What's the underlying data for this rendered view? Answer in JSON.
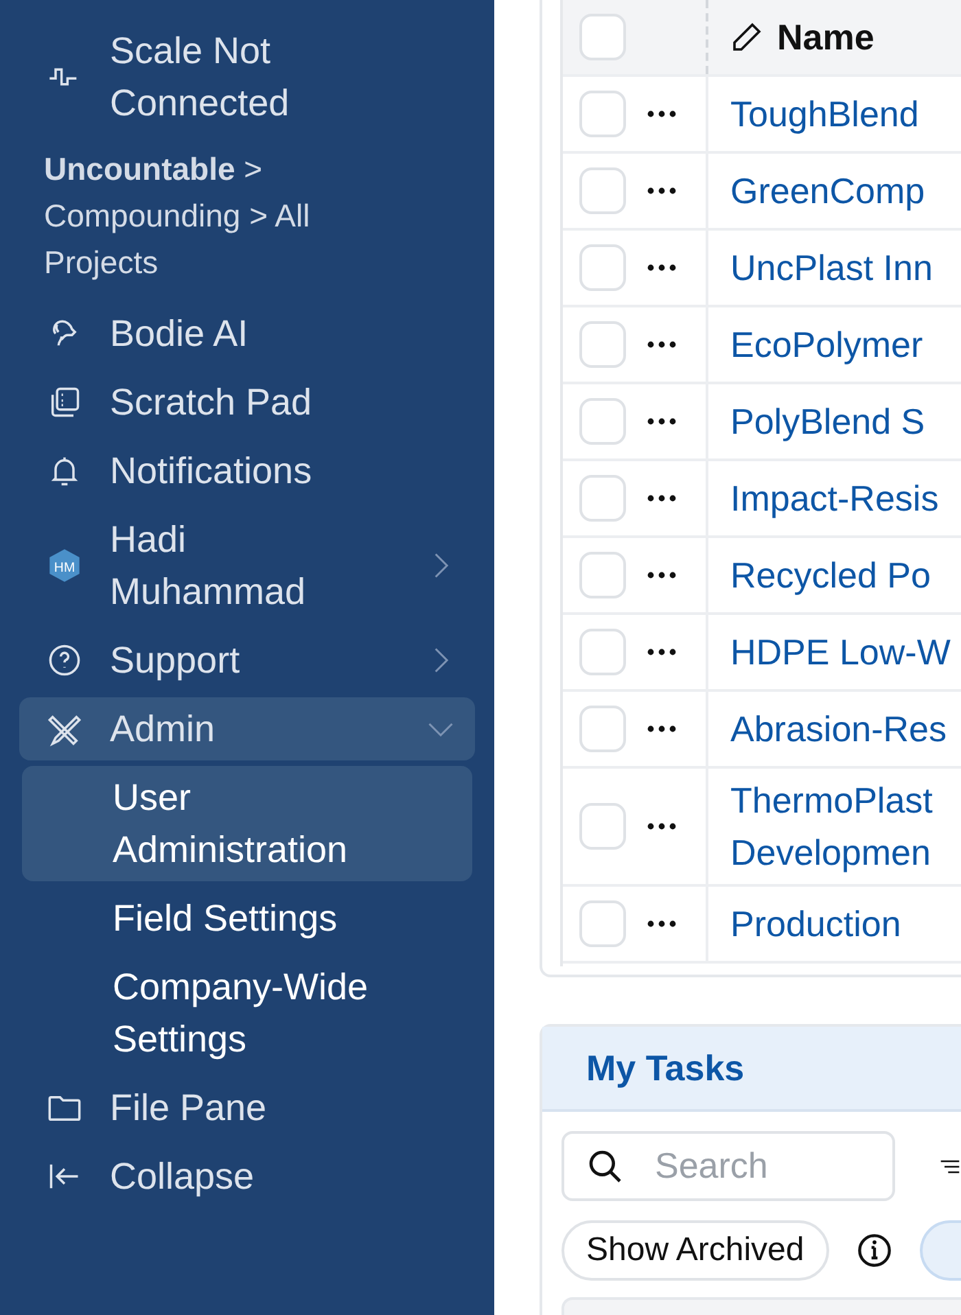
{
  "sidebar": {
    "scale_status": "Scale Not Connected",
    "breadcrumb": {
      "root": "Uncountable",
      "path": " > Compounding > All Projects"
    },
    "items": [
      {
        "kind": "nav",
        "label": "Bodie AI"
      },
      {
        "kind": "nav",
        "label": "Scratch Pad"
      },
      {
        "kind": "nav",
        "label": "Notifications"
      },
      {
        "kind": "user",
        "initials": "HM",
        "label": "Hadi Muhammad",
        "expanded": false
      },
      {
        "kind": "nav",
        "label": "Support",
        "expanded": false
      },
      {
        "kind": "nav",
        "label": "Admin",
        "expanded": true,
        "children": [
          {
            "label": "User Administration",
            "selected": true
          },
          {
            "label": "Field Settings",
            "selected": false
          },
          {
            "label": "Company-Wide Settings",
            "selected": false
          }
        ]
      },
      {
        "kind": "nav",
        "label": "File Pane"
      },
      {
        "kind": "nav",
        "label": "Collapse"
      }
    ]
  },
  "projects_table": {
    "all_selected": false,
    "columns": [
      {
        "label": "Name"
      }
    ],
    "rows": [
      {
        "checked": false,
        "name": "ToughBlend"
      },
      {
        "checked": false,
        "name": "GreenComp"
      },
      {
        "checked": false,
        "name": "UncPlast Inn"
      },
      {
        "checked": false,
        "name": "EcoPolymer"
      },
      {
        "checked": false,
        "name": "PolyBlend S"
      },
      {
        "checked": false,
        "name": "Impact-Resis"
      },
      {
        "checked": false,
        "name": "Recycled Po"
      },
      {
        "checked": false,
        "name": "HDPE Low-W"
      },
      {
        "checked": false,
        "name": "Abrasion-Res"
      },
      {
        "checked": false,
        "name": "ThermoPlast Developmen"
      },
      {
        "checked": false,
        "name": "Production"
      }
    ]
  },
  "my_tasks": {
    "title": "My Tasks",
    "search": {
      "placeholder": "Search"
    },
    "show_archived": {
      "label": "Show Archived",
      "on": false
    }
  }
}
